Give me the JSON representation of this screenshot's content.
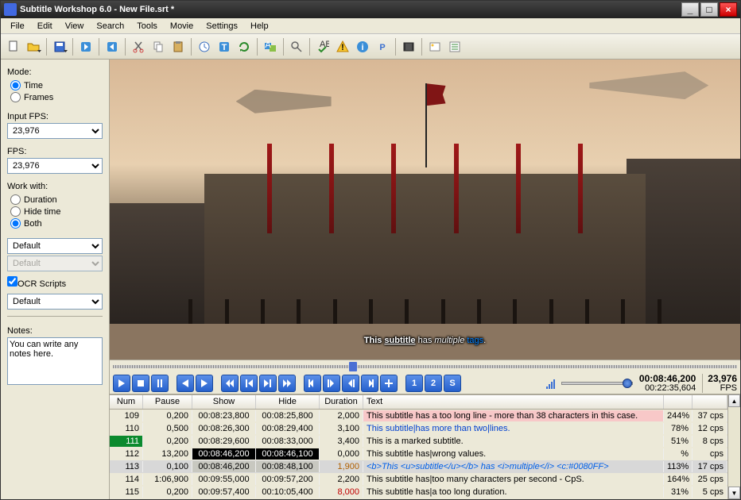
{
  "title": "Subtitle Workshop 6.0 - New File.srt *",
  "menu": [
    "File",
    "Edit",
    "View",
    "Search",
    "Tools",
    "Movie",
    "Settings",
    "Help"
  ],
  "sidebar": {
    "mode_label": "Mode:",
    "mode_time": "Time",
    "mode_frames": "Frames",
    "input_fps_label": "Input FPS:",
    "input_fps": "23,976",
    "fps_label": "FPS:",
    "fps": "23,976",
    "work_label": "Work with:",
    "work_duration": "Duration",
    "work_hide": "Hide time",
    "work_both": "Both",
    "combo1": "Default",
    "combo2": "Default",
    "ocr": "OCR Scripts",
    "combo3": "Default",
    "notes_label": "Notes:",
    "notes": "You can write any notes here."
  },
  "subtitle_render": {
    "t1": "This ",
    "t2": "subtitle",
    "t3": " has ",
    "t4": "multiple",
    "t5": " ",
    "t6": "tags",
    "t7": "."
  },
  "time": {
    "current": "00:08:46,200",
    "total": "00:22:35,604",
    "fps": "23,976",
    "fps_label": "FPS"
  },
  "headers": {
    "num": "Num",
    "pause": "Pause",
    "show": "Show",
    "hide": "Hide",
    "dur": "Duration",
    "text": "Text"
  },
  "rows": [
    {
      "num": "109",
      "pause": "0,200",
      "show": "00:08:23,800",
      "hide": "00:08:25,800",
      "dur": "2,000",
      "text": "This subtitle has a too long line - more than 38 characters in this case.",
      "pct": "244%",
      "cps": "37 cps",
      "cls": "pink"
    },
    {
      "num": "110",
      "pause": "0,500",
      "show": "00:08:26,300",
      "hide": "00:08:29,400",
      "dur": "3,100",
      "text": "This subtitle|has more than two|lines.",
      "pct": "78%",
      "cps": "12 cps",
      "cls": "bluetext"
    },
    {
      "num": "111",
      "pause": "0,200",
      "show": "00:08:29,600",
      "hide": "00:08:33,000",
      "dur": "3,400",
      "text": "This is a marked subtitle.",
      "pct": "51%",
      "cps": "8 cps",
      "cls": "marked"
    },
    {
      "num": "112",
      "pause": "13,200",
      "show": "00:08:46,200",
      "hide": "00:08:46,100",
      "dur": "0,000",
      "text": "This subtitle has|wrong values.",
      "pct": "%",
      "cps": "cps",
      "cls": "invalid"
    },
    {
      "num": "113",
      "pause": "0,100",
      "show": "00:08:46,200",
      "hide": "00:08:48,100",
      "dur": "1,900",
      "text": "<b>This <u>subtitle</u></b> has <i>multiple</i> <c:#0080FF>",
      "pct": "113%",
      "cps": "17 cps",
      "cls": "sel"
    },
    {
      "num": "114",
      "pause": "1:06,900",
      "show": "00:09:55,000",
      "hide": "00:09:57,200",
      "dur": "2,200",
      "text": "This subtitle has|too many characters per second - CpS.",
      "pct": "164%",
      "cps": "25 cps",
      "cls": ""
    },
    {
      "num": "115",
      "pause": "0,200",
      "show": "00:09:57,400",
      "hide": "00:10:05,400",
      "dur": "8,000",
      "text": "This subtitle has|a too long duration.",
      "pct": "31%",
      "cps": "5 cps",
      "cls": "longdur"
    }
  ]
}
